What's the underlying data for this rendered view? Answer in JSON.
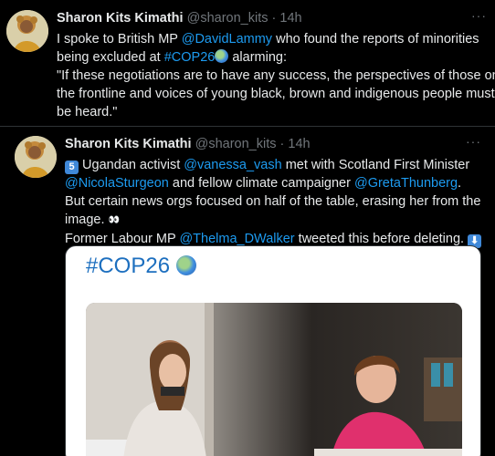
{
  "tweet1": {
    "name": "Sharon Kits Kimathi",
    "handle": "@sharon_kits",
    "separator": "·",
    "time": "14h",
    "more": "···",
    "line1_text": "I spoke to British MP ",
    "line1_mention": "@DavidLammy",
    "line1_tail": " who found the reports of minorities",
    "line2_text": "being excluded at ",
    "line2_hashtag": "#COP26",
    "line2_tail": " alarming:",
    "line3": "\"If these negotiations are to have any success, the perspectives of those on",
    "line4": "the frontline and voices of young black, brown and indigenous people must",
    "line5": "be heard.\""
  },
  "tweet2": {
    "name": "Sharon Kits Kimathi",
    "handle": "@sharon_kits",
    "separator": "·",
    "time": "14h",
    "more": "···",
    "number_emoji": "5",
    "line1_text": " Ugandan activist ",
    "line1_mention": "@vanessa_vash",
    "line1_tail": " met with Scotland First Minister",
    "line2_mention": "@NicolaSturgeon",
    "line2_mid": " and fellow climate campaigner ",
    "line2_mention2": "@GretaThunberg",
    "line2_tail": ".",
    "line3": "But certain news orgs focused on half of the table, erasing her from the",
    "line4": "image. ",
    "line4_emoji": "👀",
    "line5_text": "Former Labour MP ",
    "line5_mention": "@Thelma_DWalker",
    "line5_tail": " tweeted this before deleting. ",
    "arrow_emoji": "⬇",
    "media_hashtag": "#COP26"
  },
  "colors": {
    "background": "#000000",
    "text": "#e7e9ea",
    "muted": "#71767b",
    "link": "#1d9bf0",
    "media_hashtag": "#1d6fbf"
  }
}
